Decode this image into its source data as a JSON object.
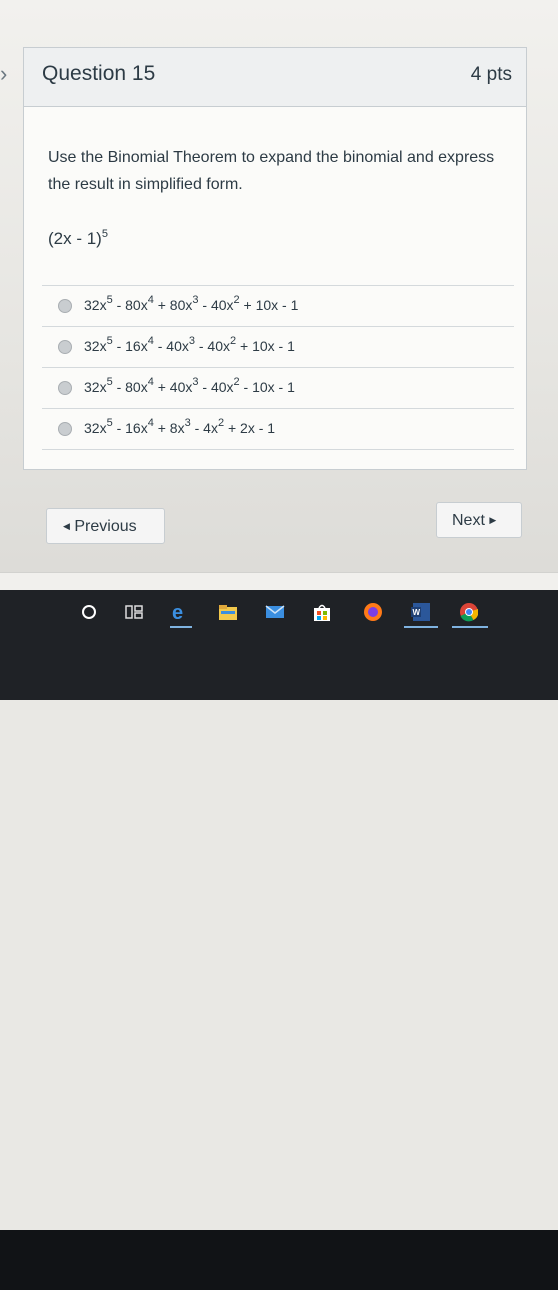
{
  "question": {
    "title": "Question 15",
    "points": "4 pts",
    "prompt": "Use the Binomial Theorem to expand the binomial and express the result in simplified form.",
    "expression": {
      "base": "(2x - 1)",
      "exp": "5"
    }
  },
  "choices": [
    {
      "parts": [
        [
          "32x",
          "5"
        ],
        [
          " - 80x",
          "4"
        ],
        [
          " + 80x",
          "3"
        ],
        [
          " - 40x",
          "2"
        ],
        [
          " + 10x - 1",
          ""
        ]
      ]
    },
    {
      "parts": [
        [
          "32x",
          "5"
        ],
        [
          " - 16x",
          "4"
        ],
        [
          " - 40x",
          "3"
        ],
        [
          " - 40x",
          "2"
        ],
        [
          " + 10x - 1",
          ""
        ]
      ]
    },
    {
      "parts": [
        [
          "32x",
          "5"
        ],
        [
          " - 80x",
          "4"
        ],
        [
          " + 40x",
          "3"
        ],
        [
          " - 40x",
          "2"
        ],
        [
          " - 10x - 1",
          ""
        ]
      ]
    },
    {
      "parts": [
        [
          "32x",
          "5"
        ],
        [
          " - 16x",
          "4"
        ],
        [
          " + 8x",
          "3"
        ],
        [
          " - 4x",
          "2"
        ],
        [
          " + 2x - 1",
          ""
        ]
      ]
    }
  ],
  "nav": {
    "previous_label": "Previous",
    "next_label": "Next"
  },
  "taskbar": {
    "icons": [
      "cortana-circle-icon",
      "task-view-icon",
      "edge-icon",
      "file-explorer-icon",
      "mail-icon",
      "store-icon",
      "firefox-icon",
      "word-icon",
      "chrome-icon"
    ]
  }
}
